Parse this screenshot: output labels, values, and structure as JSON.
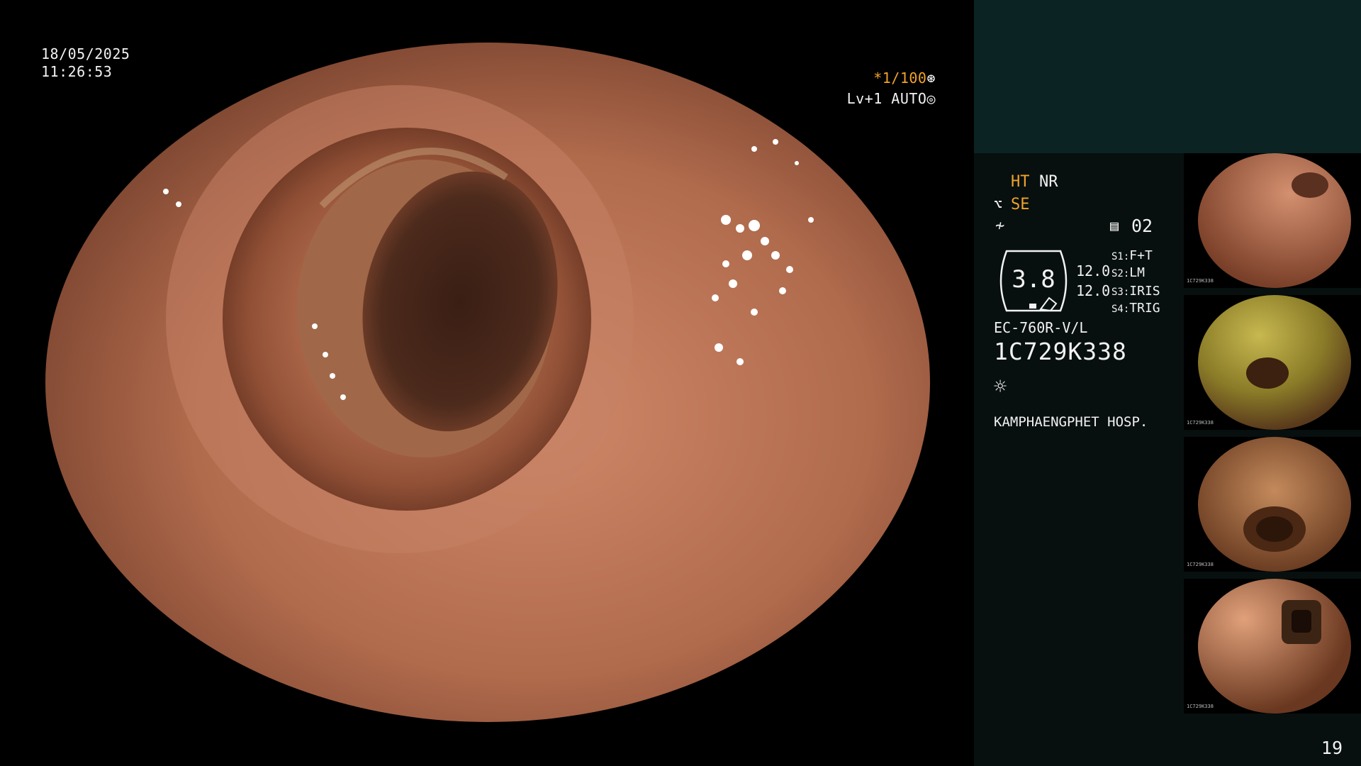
{
  "overlay": {
    "date": "18/05/2025",
    "time": "11:26:53",
    "shutter": "*1/100",
    "shutter_icon": "⊛",
    "iris": "Lv+1 AUTO",
    "iris_icon": "◎"
  },
  "panel": {
    "mode_ht": "HT",
    "mode_nr": "NR",
    "mode_se": "SE",
    "memo_icon": "▤",
    "memo_num": "02",
    "gauge_value": "3.8",
    "value_a": "12.0",
    "value_b": "12.0",
    "switches": [
      {
        "key": "S1:",
        "val": "F+T"
      },
      {
        "key": "S2:",
        "val": "LM"
      },
      {
        "key": "S3:",
        "val": "IRIS"
      },
      {
        "key": "S4:",
        "val": "TRIG"
      }
    ],
    "scope_model": "EC-760R-V/L",
    "serial": "1C729K338",
    "hospital": "KAMPHAENGPHET HOSP."
  },
  "thumbnails": [
    {
      "caption": "1C729K338"
    },
    {
      "caption": "1C729K338"
    },
    {
      "caption": "1C729K338"
    },
    {
      "caption": "1C729K338"
    }
  ],
  "page_number": "19"
}
